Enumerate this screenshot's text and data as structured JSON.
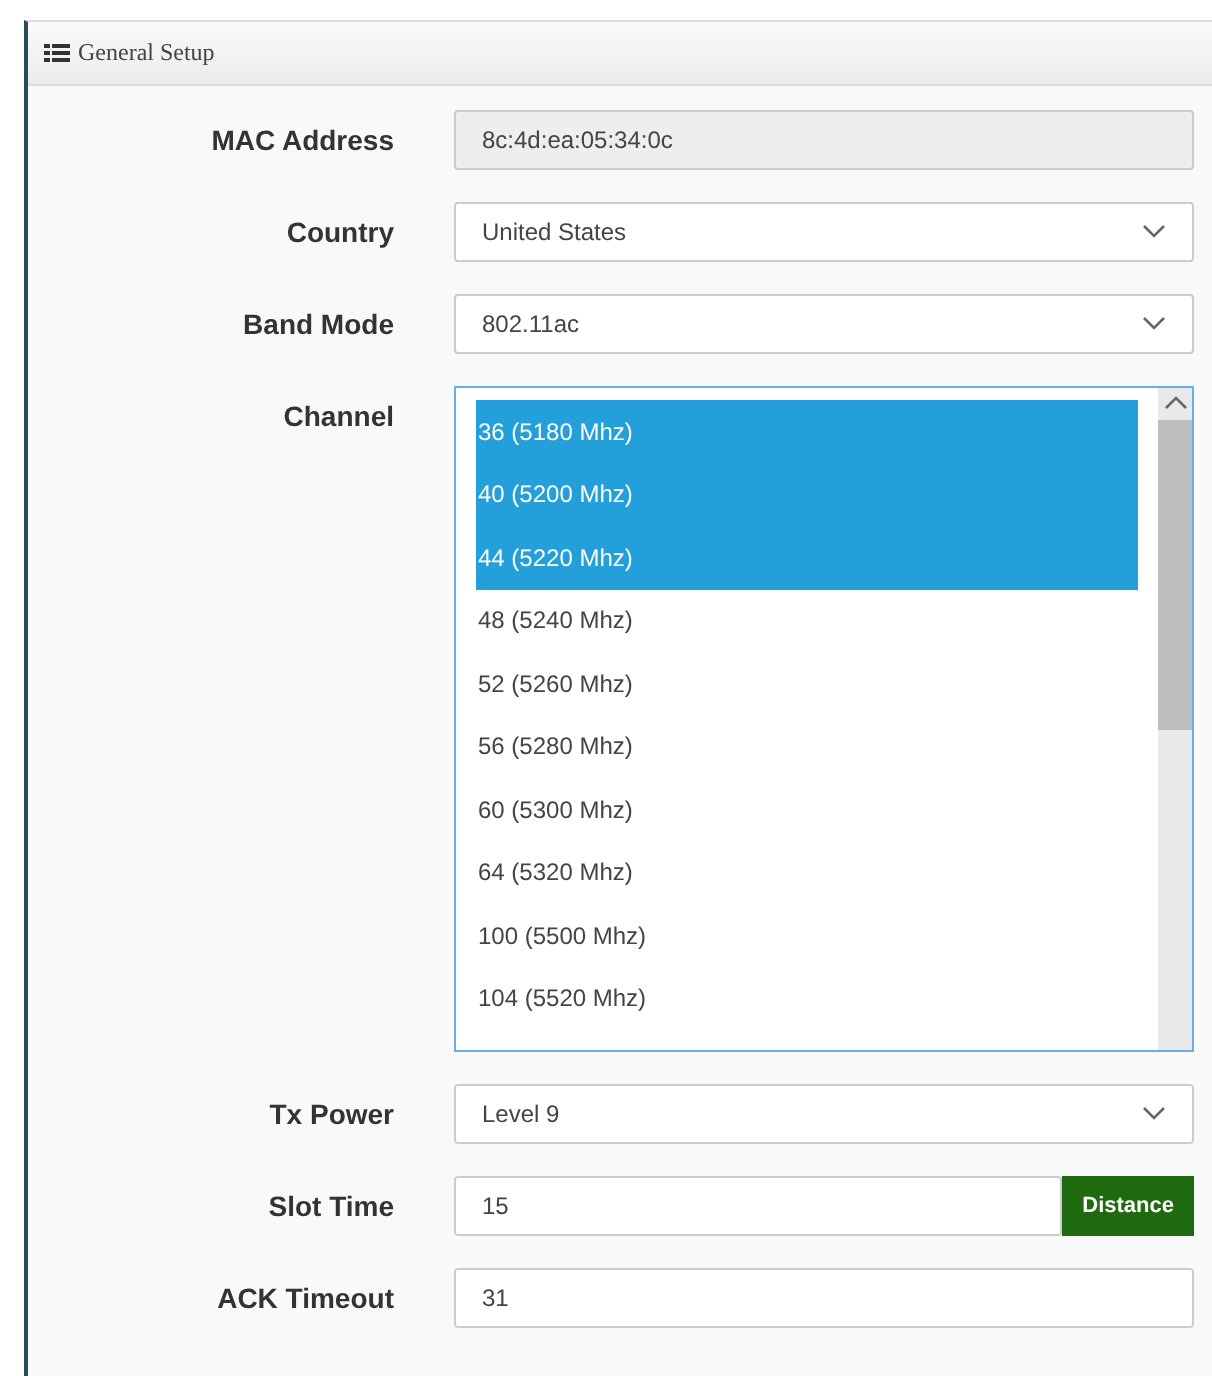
{
  "panel": {
    "title": "General Setup"
  },
  "fields": [
    {
      "kind": "readonly",
      "label": "MAC Address",
      "value": "8c:4d:ea:05:34:0c"
    },
    {
      "kind": "select",
      "label": "Country",
      "value": "United States"
    },
    {
      "kind": "select",
      "label": "Band Mode",
      "value": "802.11ac"
    },
    {
      "kind": "listbox",
      "label": "Channel",
      "options": [
        {
          "text": "36 (5180 Mhz)",
          "selected": true
        },
        {
          "text": "40 (5200 Mhz)",
          "selected": true
        },
        {
          "text": "44 (5220 Mhz)",
          "selected": true
        },
        {
          "text": "48 (5240 Mhz)",
          "selected": false
        },
        {
          "text": "52 (5260 Mhz)",
          "selected": false
        },
        {
          "text": "56 (5280 Mhz)",
          "selected": false
        },
        {
          "text": "60 (5300 Mhz)",
          "selected": false
        },
        {
          "text": "64 (5320 Mhz)",
          "selected": false
        },
        {
          "text": "100 (5500 Mhz)",
          "selected": false
        },
        {
          "text": "104 (5520 Mhz)",
          "selected": false
        }
      ]
    },
    {
      "kind": "select",
      "label": "Tx Power",
      "value": "Level 9"
    },
    {
      "kind": "text",
      "label": "Slot Time",
      "value": "15",
      "button": "Distance"
    },
    {
      "kind": "text",
      "label": "ACK Timeout",
      "value": "31"
    }
  ]
}
